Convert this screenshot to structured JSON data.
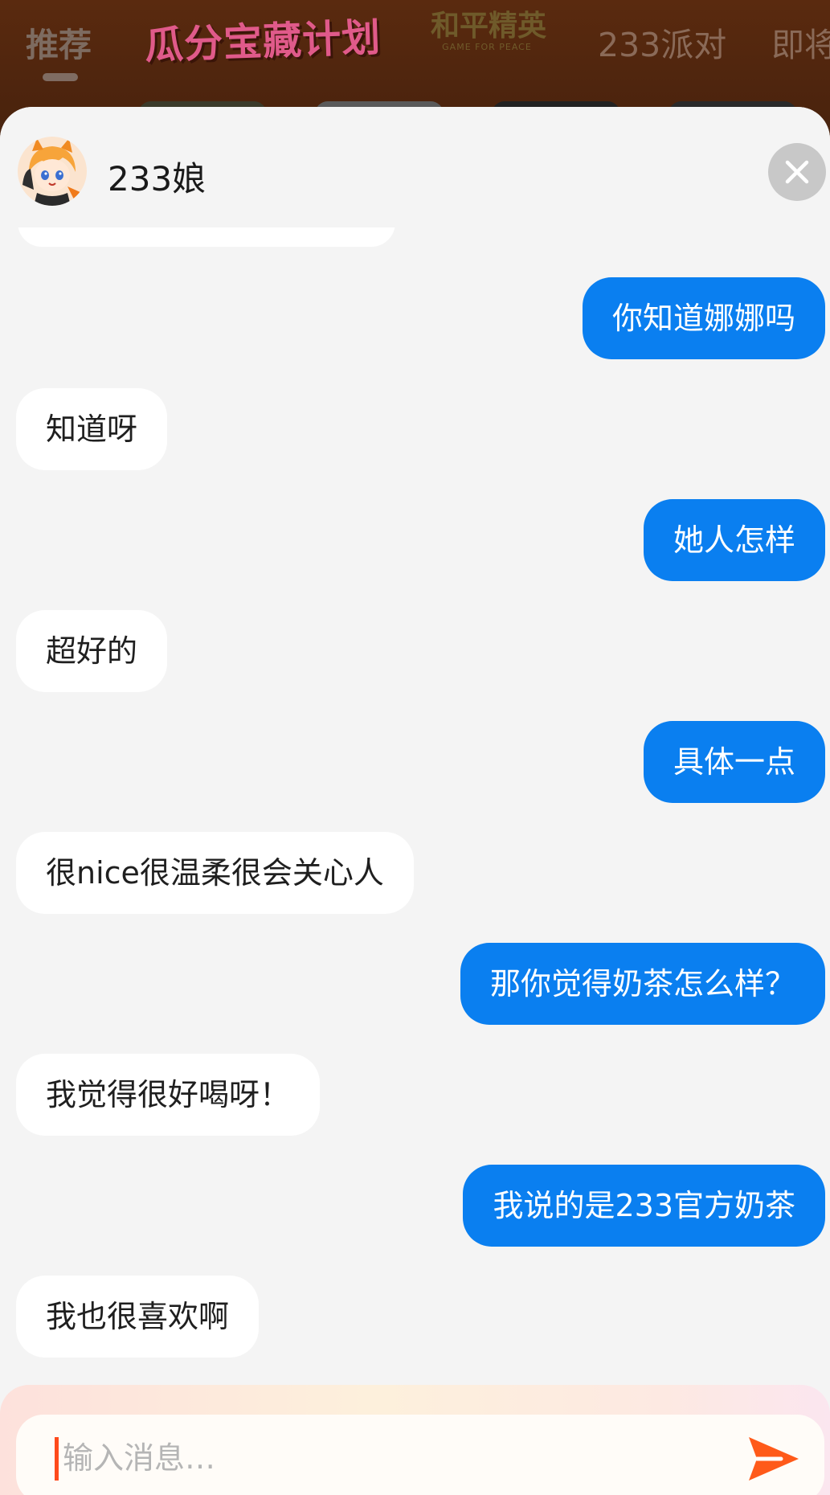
{
  "top_tabs": {
    "recommend": "推荐",
    "banner_treasure": "瓜分宝藏计划",
    "banner_game": "和平精英",
    "banner_game_sub": "GAME FOR PEACE",
    "party": "233派对",
    "soon": "即将"
  },
  "chat": {
    "title": "233娘",
    "messages": [
      {
        "role": "user",
        "text": "你知道娜娜吗"
      },
      {
        "role": "bot",
        "text": "知道呀"
      },
      {
        "role": "user",
        "text": "她人怎样"
      },
      {
        "role": "bot",
        "text": "超好的"
      },
      {
        "role": "user",
        "text": "具体一点"
      },
      {
        "role": "bot",
        "text": "很nice很温柔很会关心人"
      },
      {
        "role": "user",
        "text": "那你觉得奶茶怎么样？"
      },
      {
        "role": "bot",
        "text": "我觉得很好喝呀！"
      },
      {
        "role": "user",
        "text": "我说的是233官方奶茶"
      },
      {
        "role": "bot",
        "text": "我也很喜欢啊"
      }
    ]
  },
  "input": {
    "placeholder": "输入消息…",
    "value": ""
  },
  "colors": {
    "user_bubble": "#0a7ff0",
    "bot_bubble": "#ffffff",
    "send_icon": "#ff5a1a",
    "caret": "#ff4a1c"
  },
  "icons": {
    "close": "close-icon",
    "send": "send-icon",
    "avatar": "avatar"
  }
}
